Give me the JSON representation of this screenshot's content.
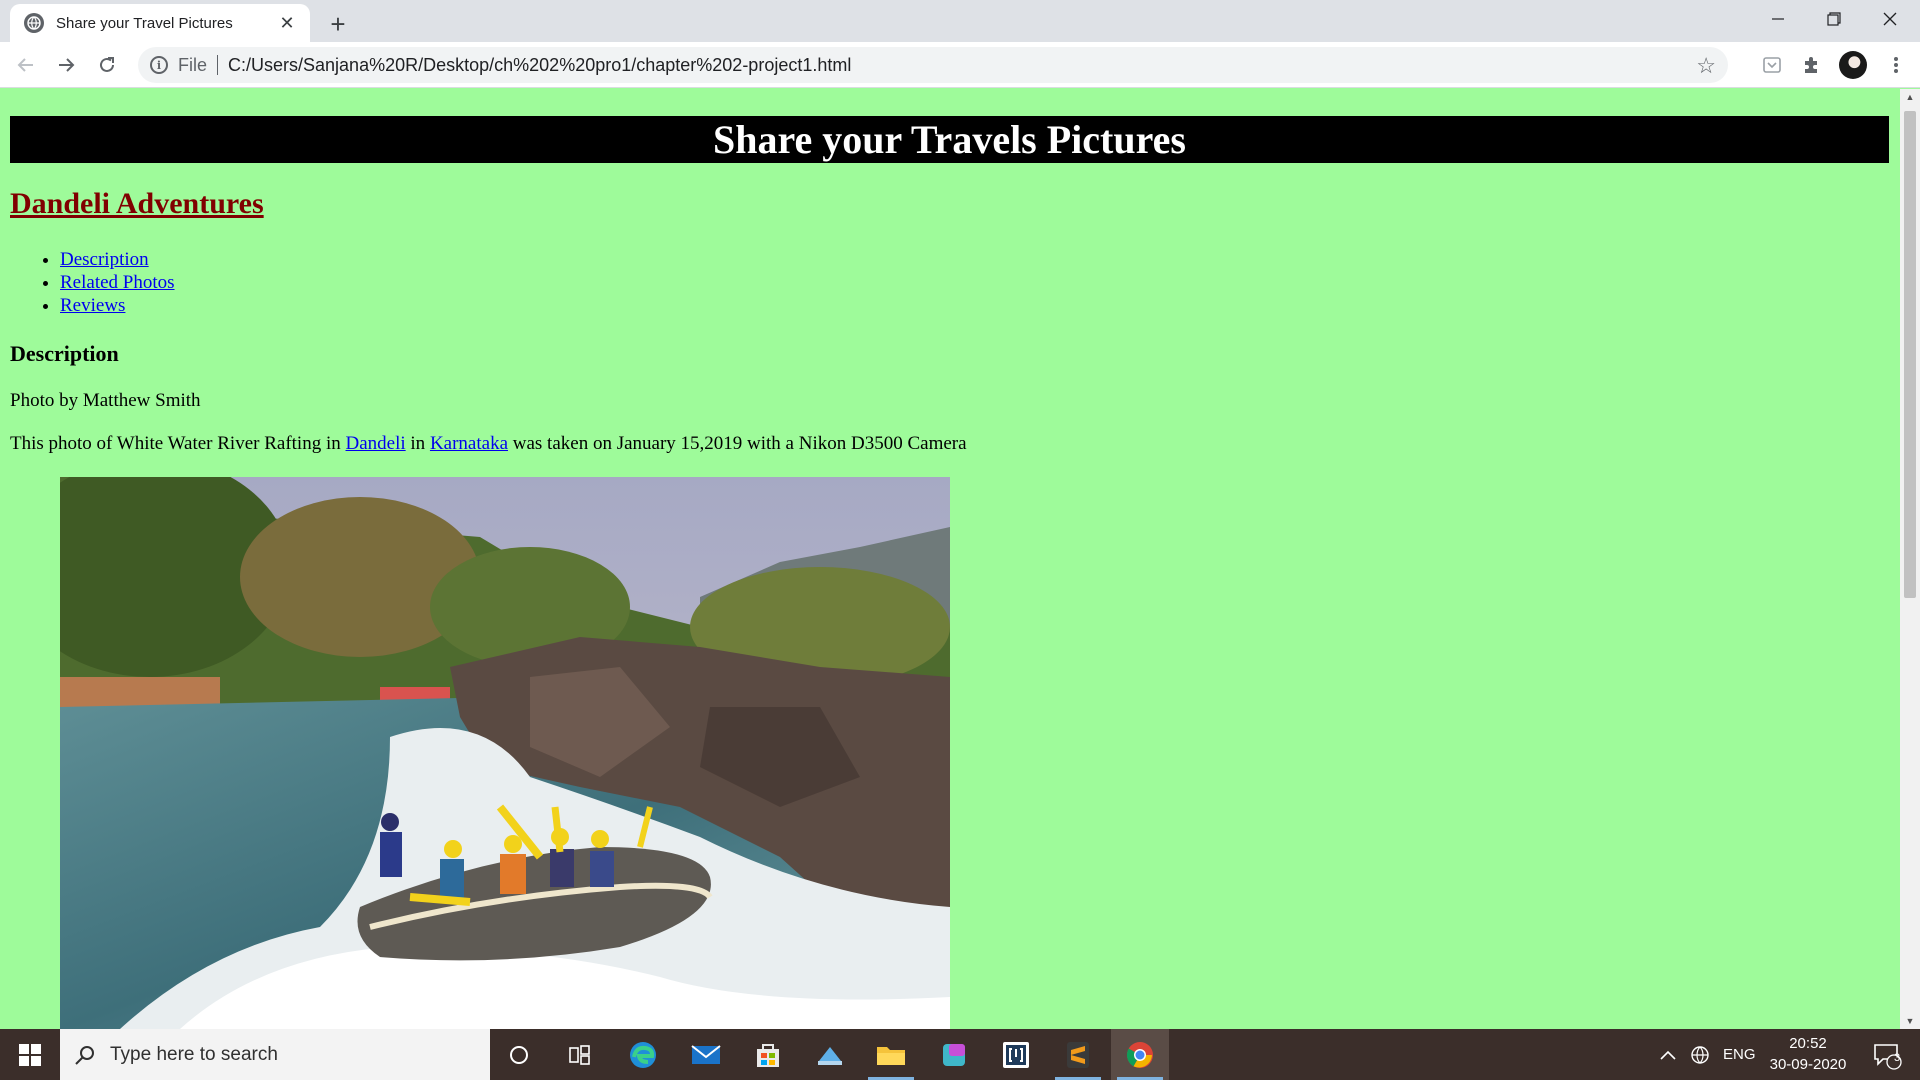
{
  "browser": {
    "tab_title": "Share your Travel Pictures",
    "address_scheme": "File",
    "address_url": "C:/Users/Sanjana%20R/Desktop/ch%202%20pro1/chapter%202-project1.html"
  },
  "page": {
    "banner_title": "Share your Travels Pictures",
    "heading": "Dandeli Adventures",
    "nav_links": [
      "Description",
      "Related Photos",
      "Reviews"
    ],
    "section_heading": "Description",
    "photo_credit": "Photo by Matthew Smith",
    "caption_part1": "This photo of White Water River Rafting in",
    "caption_link1": "Dandeli",
    "caption_in": "in",
    "caption_link2": "Karnataka",
    "caption_part2": "was taken on January 15,2019 with a Nikon D3500 Camera",
    "background_color": "#9efb9a",
    "heading_color": "#800000",
    "link_color": "#0000ee"
  },
  "taskbar": {
    "search_placeholder": "Type here to search",
    "language": "ENG",
    "time": "20:52",
    "date": "30-09-2020",
    "notification_count": "3"
  }
}
